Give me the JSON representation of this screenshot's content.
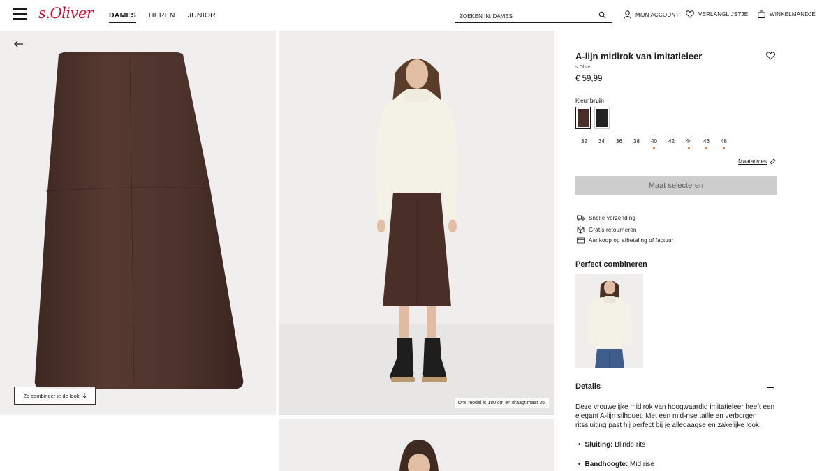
{
  "header": {
    "logo": "s.Oliver",
    "nav": [
      "DAMES",
      "HEREN",
      "JUNIOR"
    ],
    "search_placeholder": "ZOEKEN IN: DAMES",
    "account": "MIJN ACCOUNT",
    "wishlist": "VERLANGLIJSTJE",
    "cart": "WINKELMANDJE"
  },
  "gallery": {
    "combine_label": "Zo combineer je de look",
    "model_note": "Ons model is 180 cm en draagt maat 36."
  },
  "product": {
    "title": "A-lijn midirok van imitatieleer",
    "brand": "s.Oliver",
    "price": "€ 59,99",
    "color_label": "Kleur",
    "color_value": "bruin",
    "sizes": [
      {
        "label": "32",
        "low_stock": false
      },
      {
        "label": "34",
        "low_stock": false
      },
      {
        "label": "36",
        "low_stock": false
      },
      {
        "label": "38",
        "low_stock": false
      },
      {
        "label": "40",
        "low_stock": true
      },
      {
        "label": "42",
        "low_stock": false
      },
      {
        "label": "44",
        "low_stock": true
      },
      {
        "label": "46",
        "low_stock": true
      },
      {
        "label": "48",
        "low_stock": true
      }
    ],
    "size_advice": "Maatadvies",
    "select_button": "Maat selecteren",
    "usps": [
      "Snelle verzending",
      "Gratis retourneren",
      "Aankoop op afbetaling of factuur"
    ],
    "perfect_heading": "Perfect combineren",
    "details_heading": "Details",
    "description": "Deze vrouwelijke midirok van hoogwaardig imitatieleer heeft een elegant A-lijn silhouet. Met een mid-rise taille en verborgen ritssluiting past hij perfect bij je alledaagse en zakelijke look.",
    "specs": [
      {
        "label": "Sluiting:",
        "value": "Blinde rits"
      },
      {
        "label": "Bandhoogte:",
        "value": "Mid rise"
      }
    ]
  },
  "colors": {
    "brand_red": "#c8102e",
    "skirt_brown": "#4a2f28",
    "low_stock_dot": "#e46c1a",
    "button_grey": "#cdcdcd"
  }
}
